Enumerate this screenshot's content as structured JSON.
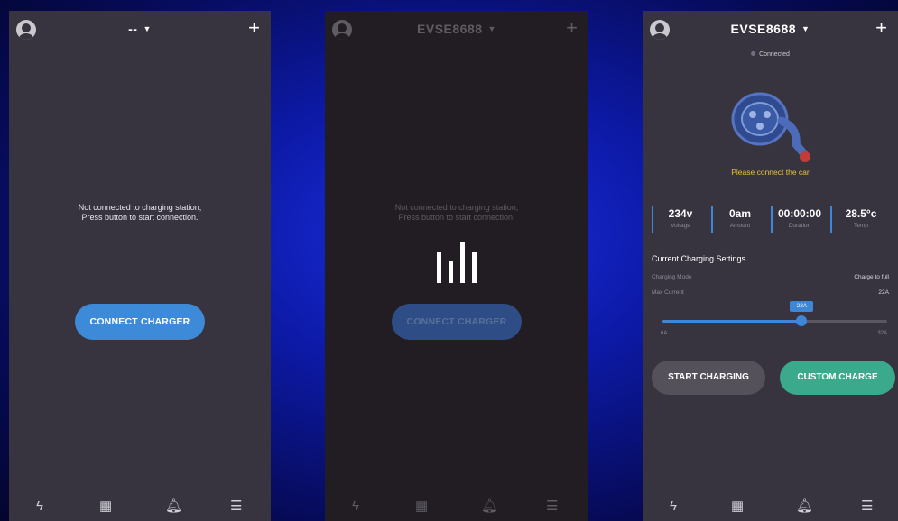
{
  "screens": [
    {
      "title": "--",
      "plus_label": "+",
      "message_line1": "Not connected to charging station,",
      "message_line2": "Press button to start connection.",
      "connect_button": "CONNECT CHARGER",
      "nav_icons": [
        "bolt-icon",
        "records-icon",
        "bell-icon",
        "menu-icon"
      ],
      "nav_glyphs": [
        "ϟ",
        "▦",
        "🔔︎",
        "☰"
      ]
    },
    {
      "title": "EVSE8688",
      "plus_label": "+",
      "message_line1": "Not connected to charging station,",
      "message_line2": "Press button to start connection.",
      "connect_button": "CONNECT CHARGER",
      "state": "connecting",
      "nav_glyphs": [
        "ϟ",
        "▦",
        "🔔︎",
        "☰"
      ]
    },
    {
      "title": "EVSE8688",
      "plus_label": "+",
      "status": "Connected",
      "warning": "Please connect the car",
      "stats": [
        {
          "value": "234v",
          "label": "Voltage"
        },
        {
          "value": "0am",
          "label": "Amount"
        },
        {
          "value": "00:00:00",
          "label": "Duration"
        },
        {
          "value": "28.5°c",
          "label": "Temp"
        }
      ],
      "settings_title": "Current Charging Settings",
      "charging_mode_label": "Charging Mode",
      "charging_mode_value": "Charge to full",
      "max_current_label": "Max Current",
      "max_current_value": "22A",
      "slider": {
        "min_label": "6A",
        "max_label": "32A",
        "value_label": "22A",
        "fraction": 0.62
      },
      "start_button": "START CHARGING",
      "custom_button": "CUSTOM CHARGE",
      "nav_glyphs": [
        "ϟ",
        "▦",
        "🔔︎",
        "☰"
      ]
    }
  ],
  "colors": {
    "background": "#0d1aa8",
    "panel": "#38343f",
    "accent_blue": "#3d8ad8",
    "accent_green": "#3ba98c",
    "warning": "#e7c23a"
  }
}
